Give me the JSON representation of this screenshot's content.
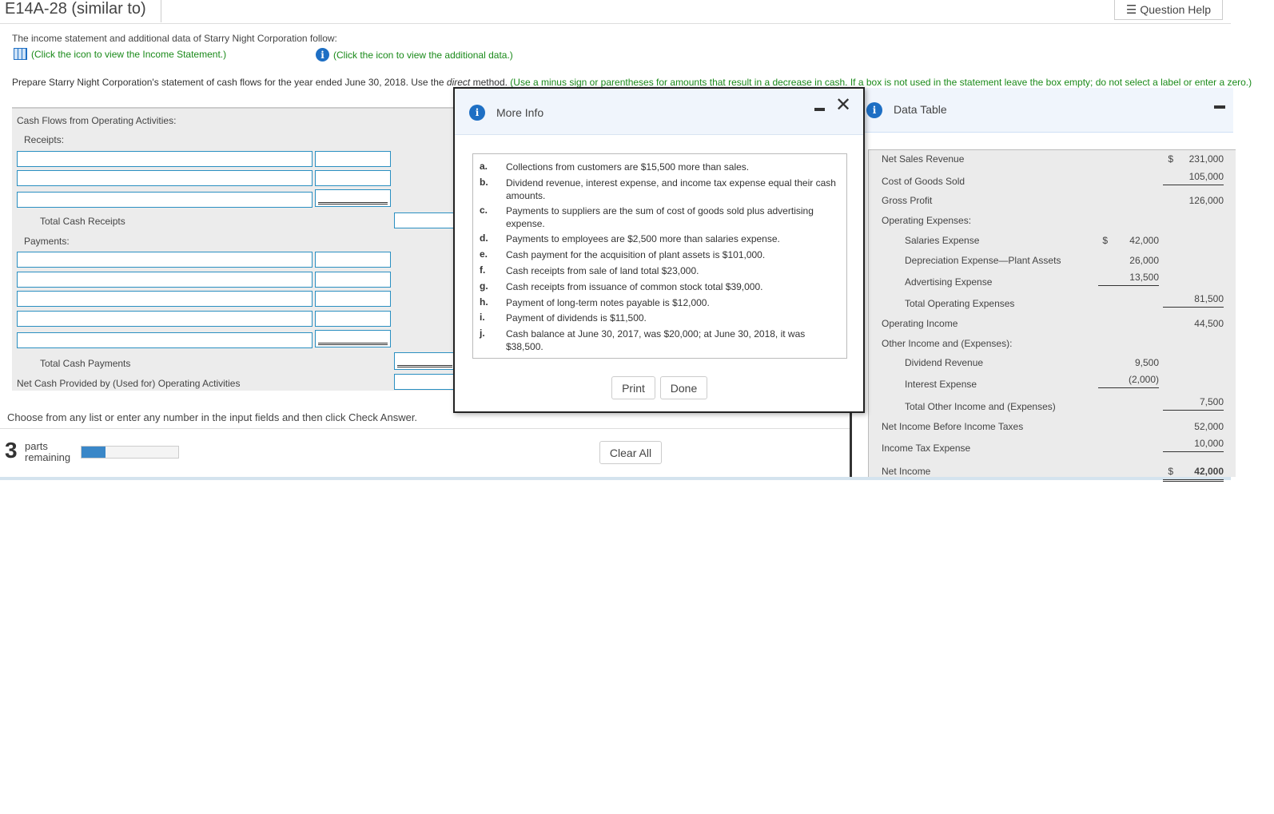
{
  "header": {
    "title": "E14A-28 (similar to)",
    "question_help": "Question Help"
  },
  "intro": {
    "text": "The income statement and additional data of Starry Night Corporation follow:",
    "income_link": "(Click the icon to view the Income Statement.)",
    "data_link": "(Click the icon to view the additional data.)"
  },
  "instructions": {
    "main": "Prepare Starry Night Corporation's statement of cash flows for the year ended June 30, 2018. Use the ",
    "method": "direct",
    "after": " method. ",
    "green": "(Use a minus sign or parentheses for amounts that result in a decrease in cash. If a box is not used in the statement leave the box empty; do not select a label or enter a zero.)"
  },
  "form": {
    "section": "Cash Flows from Operating Activities:",
    "receipts": "Receipts:",
    "total_receipts": "Total Cash Receipts",
    "payments": "Payments:",
    "total_payments": "Total Cash Payments",
    "net": "Net Cash Provided by (Used for) Operating Activities"
  },
  "footer": {
    "hint": "Choose from any list or enter any number in the input fields and then click Check Answer.",
    "parts_count": "3",
    "parts_label": "parts",
    "remaining_label": "remaining",
    "progress_fraction": 0.25,
    "clear_all": "Clear All"
  },
  "more_info": {
    "title": "More Info",
    "print": "Print",
    "done": "Done",
    "notes": [
      {
        "k": "a.",
        "t": "Collections from customers are $15,500 more than sales."
      },
      {
        "k": "b.",
        "t": "Dividend revenue, interest expense, and income tax expense equal their cash amounts."
      },
      {
        "k": "c.",
        "t": "Payments to suppliers are the sum of cost of goods sold plus advertising expense."
      },
      {
        "k": "d.",
        "t": "Payments to employees are $2,500 more than salaries expense."
      },
      {
        "k": "e.",
        "t": "Cash payment for the acquisition of plant assets is $101,000."
      },
      {
        "k": "f.",
        "t": "Cash receipts from sale of land total $23,000."
      },
      {
        "k": "g.",
        "t": "Cash receipts from issuance of common stock total $39,000."
      },
      {
        "k": "h.",
        "t": "Payment of long-term notes payable is $12,000."
      },
      {
        "k": "i.",
        "t": "Payment of dividends is $11,500."
      },
      {
        "k": "j.",
        "t": "Cash balance at June 30, 2017, was $20,000; at June 30, 2018, it was $38,500."
      }
    ]
  },
  "data_table": {
    "title": "Data Table",
    "rows": [
      {
        "label": "Net Sales Revenue",
        "c1": "",
        "c2": "231,000",
        "d2": "$"
      },
      {
        "label": "Cost of Goods Sold",
        "c1": "",
        "c2": "105,000",
        "u2": true
      },
      {
        "label": "Gross Profit",
        "c1": "",
        "c2": "126,000"
      },
      {
        "label": "Operating Expenses:",
        "c1": "",
        "c2": ""
      },
      {
        "label": "Salaries Expense",
        "ind": true,
        "c1": "42,000",
        "d1": "$",
        "c2": ""
      },
      {
        "label": "Depreciation Expense—Plant Assets",
        "ind": true,
        "c1": "26,000",
        "c2": ""
      },
      {
        "label": "Advertising Expense",
        "ind": true,
        "c1": "13,500",
        "u1": true,
        "c2": ""
      },
      {
        "label": "Total Operating Expenses",
        "ind": true,
        "c1": "",
        "c2": "81,500",
        "u2": true
      },
      {
        "label": "Operating Income",
        "c1": "",
        "c2": "44,500"
      },
      {
        "label": "Other Income and (Expenses):",
        "c1": "",
        "c2": ""
      },
      {
        "label": "Dividend Revenue",
        "ind": true,
        "c1": "9,500",
        "c2": ""
      },
      {
        "label": "Interest Expense",
        "ind": true,
        "c1": "(2,000)",
        "u1": true,
        "c2": ""
      },
      {
        "label": "Total Other Income and (Expenses)",
        "ind": true,
        "c1": "",
        "c2": "7,500",
        "u2": true
      },
      {
        "label": "Net Income Before Income Taxes",
        "c1": "",
        "c2": "52,000"
      },
      {
        "label": "Income Tax Expense",
        "c1": "",
        "c2": "10,000",
        "u2": true
      },
      {
        "label": "Net Income",
        "c1": "",
        "c2": "42,000",
        "d2": "$",
        "bold": true
      }
    ]
  }
}
